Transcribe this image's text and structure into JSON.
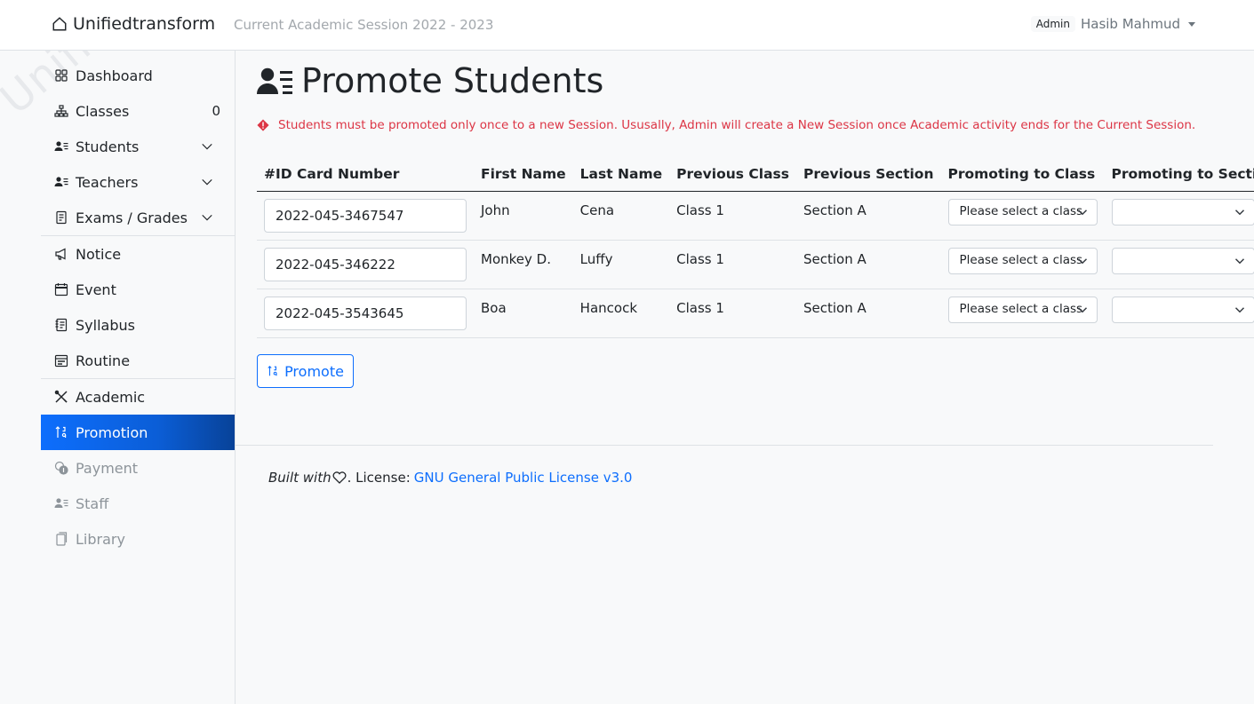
{
  "app": {
    "brand": "Unifiedtransform",
    "session_label": "Current Academic Session 2022 - 2023",
    "user_role": "Admin",
    "user_name": "Hasib Mahmud",
    "watermark": "Unifiedtransform"
  },
  "sidebar": {
    "items": [
      {
        "label": "Dashboard",
        "icon": "grid-icon"
      },
      {
        "label": "Classes",
        "icon": "diagram-icon",
        "count": "0"
      },
      {
        "label": "Students",
        "icon": "person-lines-icon"
      },
      {
        "label": "Teachers",
        "icon": "person-lines-icon"
      },
      {
        "label": "Exams / Grades",
        "icon": "file-text-icon"
      },
      {
        "label": "Notice",
        "icon": "megaphone-icon"
      },
      {
        "label": "Event",
        "icon": "calendar-icon"
      },
      {
        "label": "Syllabus",
        "icon": "journal-icon"
      },
      {
        "label": "Routine",
        "icon": "calendar-range-icon"
      },
      {
        "label": "Academic",
        "icon": "tools-icon"
      },
      {
        "label": "Promotion",
        "icon": "sort-numeric-icon"
      },
      {
        "label": "Payment",
        "icon": "coins-icon"
      },
      {
        "label": "Staff",
        "icon": "person-lines-icon"
      },
      {
        "label": "Library",
        "icon": "journals-icon"
      }
    ]
  },
  "page": {
    "title": "Promote Students",
    "alert": "Students must be promoted only once to a new Session. Ususally, Admin will create a New Session once Academic activity ends for the Current Session."
  },
  "table": {
    "headers": [
      "#ID Card Number",
      "First Name",
      "Last Name",
      "Previous Class",
      "Previous Section",
      "Promoting to Class",
      "Promoting to Section"
    ],
    "rows": [
      {
        "id": "2022-045-3467547",
        "first": "John",
        "last": "Cena",
        "prev_class": "Class 1",
        "prev_section": "Section A",
        "class_select": "Please select a class",
        "section_select": ""
      },
      {
        "id": "2022-045-346222",
        "first": "Monkey D.",
        "last": "Luffy",
        "prev_class": "Class 1",
        "prev_section": "Section A",
        "class_select": "Please select a class",
        "section_select": ""
      },
      {
        "id": "2022-045-3543645",
        "first": "Boa",
        "last": "Hancock",
        "prev_class": "Class 1",
        "prev_section": "Section A",
        "class_select": "Please select a class",
        "section_select": ""
      }
    ]
  },
  "actions": {
    "promote_label": "Promote"
  },
  "footer": {
    "built_with": "Built with",
    "license_prefix": ". License:",
    "license_link": "GNU General Public License v3.0"
  },
  "colors": {
    "primary": "#0d6efd",
    "danger": "#dc3545",
    "muted": "#6c757d"
  }
}
